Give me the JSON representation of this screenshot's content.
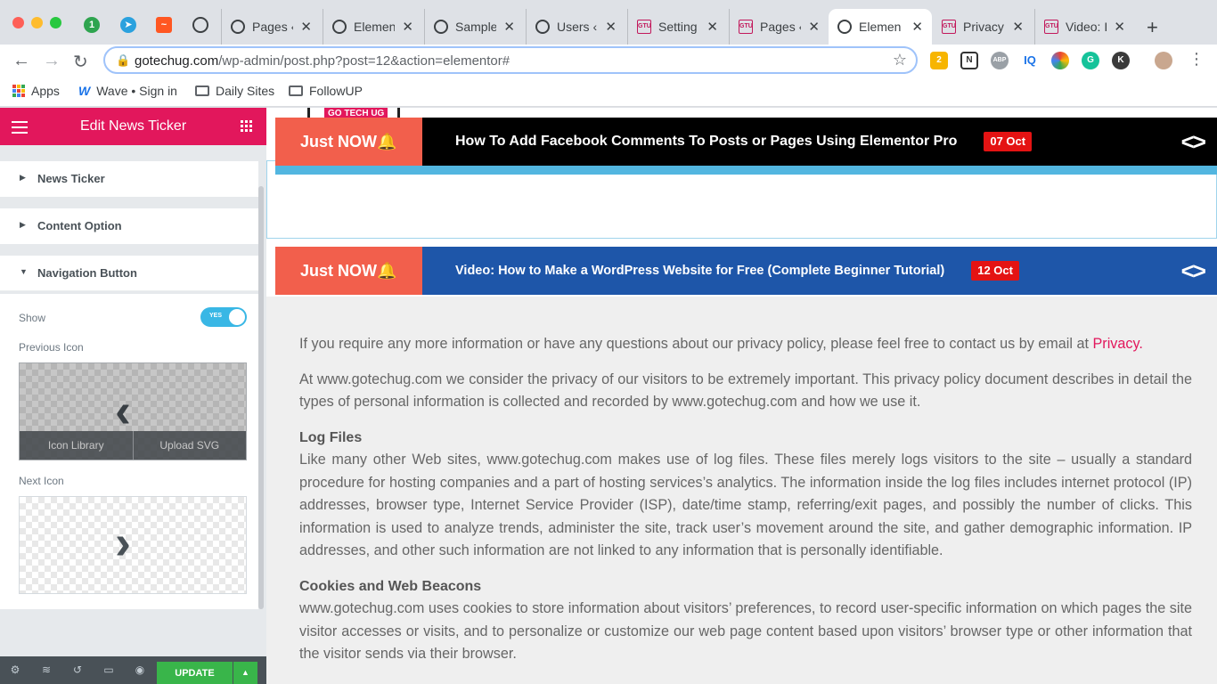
{
  "browser": {
    "tabs": [
      {
        "title": "Pages ‹"
      },
      {
        "title": "Element"
      },
      {
        "title": "Sample"
      },
      {
        "title": "Users ‹"
      },
      {
        "title": "Setting"
      },
      {
        "title": "Pages ‹"
      },
      {
        "title": "Elemen"
      },
      {
        "title": "Privacy"
      },
      {
        "title": "Video: I"
      }
    ],
    "url_domain": "gotechug.com",
    "url_path": "/wp-admin/post.php?post=12&action=elementor#",
    "extensions": [
      "2",
      "N",
      "ABP",
      "IQ",
      "K"
    ],
    "bookmarks": [
      {
        "label": "Apps"
      },
      {
        "label": "Wave • Sign in"
      },
      {
        "label": "Daily Sites"
      },
      {
        "label": "FollowUP"
      }
    ]
  },
  "panel": {
    "title": "Edit News Ticker",
    "sections": [
      {
        "label": "News Ticker"
      },
      {
        "label": "Content Option"
      },
      {
        "label": "Navigation Button"
      }
    ],
    "show_label": "Show",
    "toggle_label": "YES",
    "previous_icon_label": "Previous Icon",
    "next_icon_label": "Next Icon",
    "icon_library": "Icon Library",
    "upload_svg": "Upload SVG",
    "prev_glyph": "‹",
    "next_glyph": "›",
    "update_label": "UPDATE"
  },
  "preview": {
    "logo_text": "GO TECH UG",
    "tickers": [
      {
        "label": "Just NOW",
        "headline": "How To Add Facebook Comments To Posts or Pages Using Elementor Pro",
        "date": "07 Oct",
        "arrows": "<>"
      },
      {
        "label": "Just NOW",
        "headline": "Video: How to Make a WordPress Website for Free (Complete Beginner Tutorial)",
        "date": "12 Oct",
        "arrows": "<>"
      }
    ],
    "para1": "If you require any more information or have any questions about our privacy policy, please feel free to contact us by email at ",
    "para1_link": "Privacy.",
    "para2": "At www.gotechug.com we consider the privacy of our visitors to be extremely important. This privacy policy document describes in detail the types of personal information is collected and recorded by www.gotechug.com and how we use it.",
    "h_log": "Log Files",
    "para3": "Like many other Web sites, www.gotechug.com makes use of log files. These files merely logs visitors to the site – usually a standard procedure for hosting companies and a part of hosting services’s analytics. The information inside the log files includes internet protocol (IP) addresses, browser type, Internet Service Provider (ISP), date/time stamp, referring/exit pages, and possibly the number of clicks. This information is used to analyze trends, administer the site, track user’s movement around the site, and gather demographic information. IP addresses, and other such information are not linked to any information that is personally identifiable.",
    "h_cookies": "Cookies and Web Beacons",
    "para4": "www.gotechug.com uses cookies to store information about visitors’ preferences, to record user-specific information on which pages the site visitor accesses or visits, and to personalize or customize our web page content based upon visitors’ browser type or other information that the visitor sends via their browser."
  },
  "colors": {
    "elementor_pink": "#e2175c",
    "ticker_label": "#f25f4c",
    "ticker_blue": "#1e56a9",
    "date_badge": "#e41313",
    "toggle_on": "#39b7e5",
    "update_green": "#39b54a"
  }
}
